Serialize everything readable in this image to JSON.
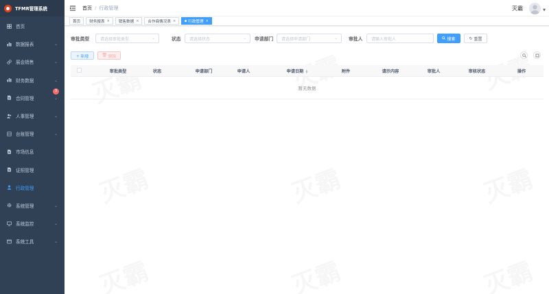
{
  "app": {
    "logo_text": "TFMR管理系统",
    "user_name": "灭霸",
    "watermark": "灭霸"
  },
  "sidebar": {
    "items": [
      {
        "label": "首页",
        "icon": "dashboard-icon",
        "has_arrow": false,
        "active": false
      },
      {
        "label": "数据报表",
        "icon": "chart-icon",
        "has_arrow": true,
        "active": false
      },
      {
        "label": "展会销售",
        "icon": "link-icon",
        "has_arrow": true,
        "active": false
      },
      {
        "label": "财务数据",
        "icon": "chart-icon",
        "has_arrow": true,
        "active": false
      },
      {
        "label": "合同管理",
        "icon": "document-icon",
        "has_arrow": true,
        "active": false,
        "badge": "3"
      },
      {
        "label": "人事管理",
        "icon": "people-icon",
        "has_arrow": true,
        "active": false
      },
      {
        "label": "台账管理",
        "icon": "ledger-icon",
        "has_arrow": true,
        "active": false
      },
      {
        "label": "市场信息",
        "icon": "document-icon",
        "has_arrow": false,
        "active": false
      },
      {
        "label": "证照管理",
        "icon": "document-icon",
        "has_arrow": false,
        "active": false
      },
      {
        "label": "行政管理",
        "icon": "user-icon",
        "has_arrow": false,
        "active": true
      },
      {
        "label": "系统管理",
        "icon": "gear-icon",
        "has_arrow": true,
        "active": false
      },
      {
        "label": "系统监控",
        "icon": "monitor-icon",
        "has_arrow": true,
        "active": false
      },
      {
        "label": "系统工具",
        "icon": "tool-icon",
        "has_arrow": true,
        "active": false
      }
    ]
  },
  "breadcrumb": {
    "home": "首页",
    "separator": "/",
    "current": "行政管理"
  },
  "tags": [
    {
      "label": "首页",
      "closable": false,
      "active": false
    },
    {
      "label": "财务报表",
      "closable": true,
      "active": false
    },
    {
      "label": "销售数据",
      "closable": true,
      "active": false
    },
    {
      "label": "合作商情况表",
      "closable": true,
      "active": false
    },
    {
      "label": "行政管理",
      "closable": true,
      "active": true
    }
  ],
  "search": {
    "type_label": "审批类型",
    "type_placeholder": "请选择审批类型",
    "status_label": "状态",
    "status_placeholder": "请选择状态",
    "dept_label": "申请部门",
    "dept_placeholder": "请选择申请部门",
    "approver_label": "审批人",
    "approver_placeholder": "请输入审批人",
    "search_button": "搜索",
    "reset_button": "重置"
  },
  "actions": {
    "add_button": "+ 新增",
    "delete_button": "删除"
  },
  "table": {
    "columns": [
      "审批类型",
      "状态",
      "申请部门",
      "申请人",
      "申请日期",
      "附件",
      "请示内容",
      "审批人",
      "审核状态",
      "操作"
    ],
    "empty_text": "暂无数据"
  },
  "colors": {
    "sidebar_bg": "#304156",
    "primary": "#409eff",
    "danger": "#f56c6c"
  }
}
